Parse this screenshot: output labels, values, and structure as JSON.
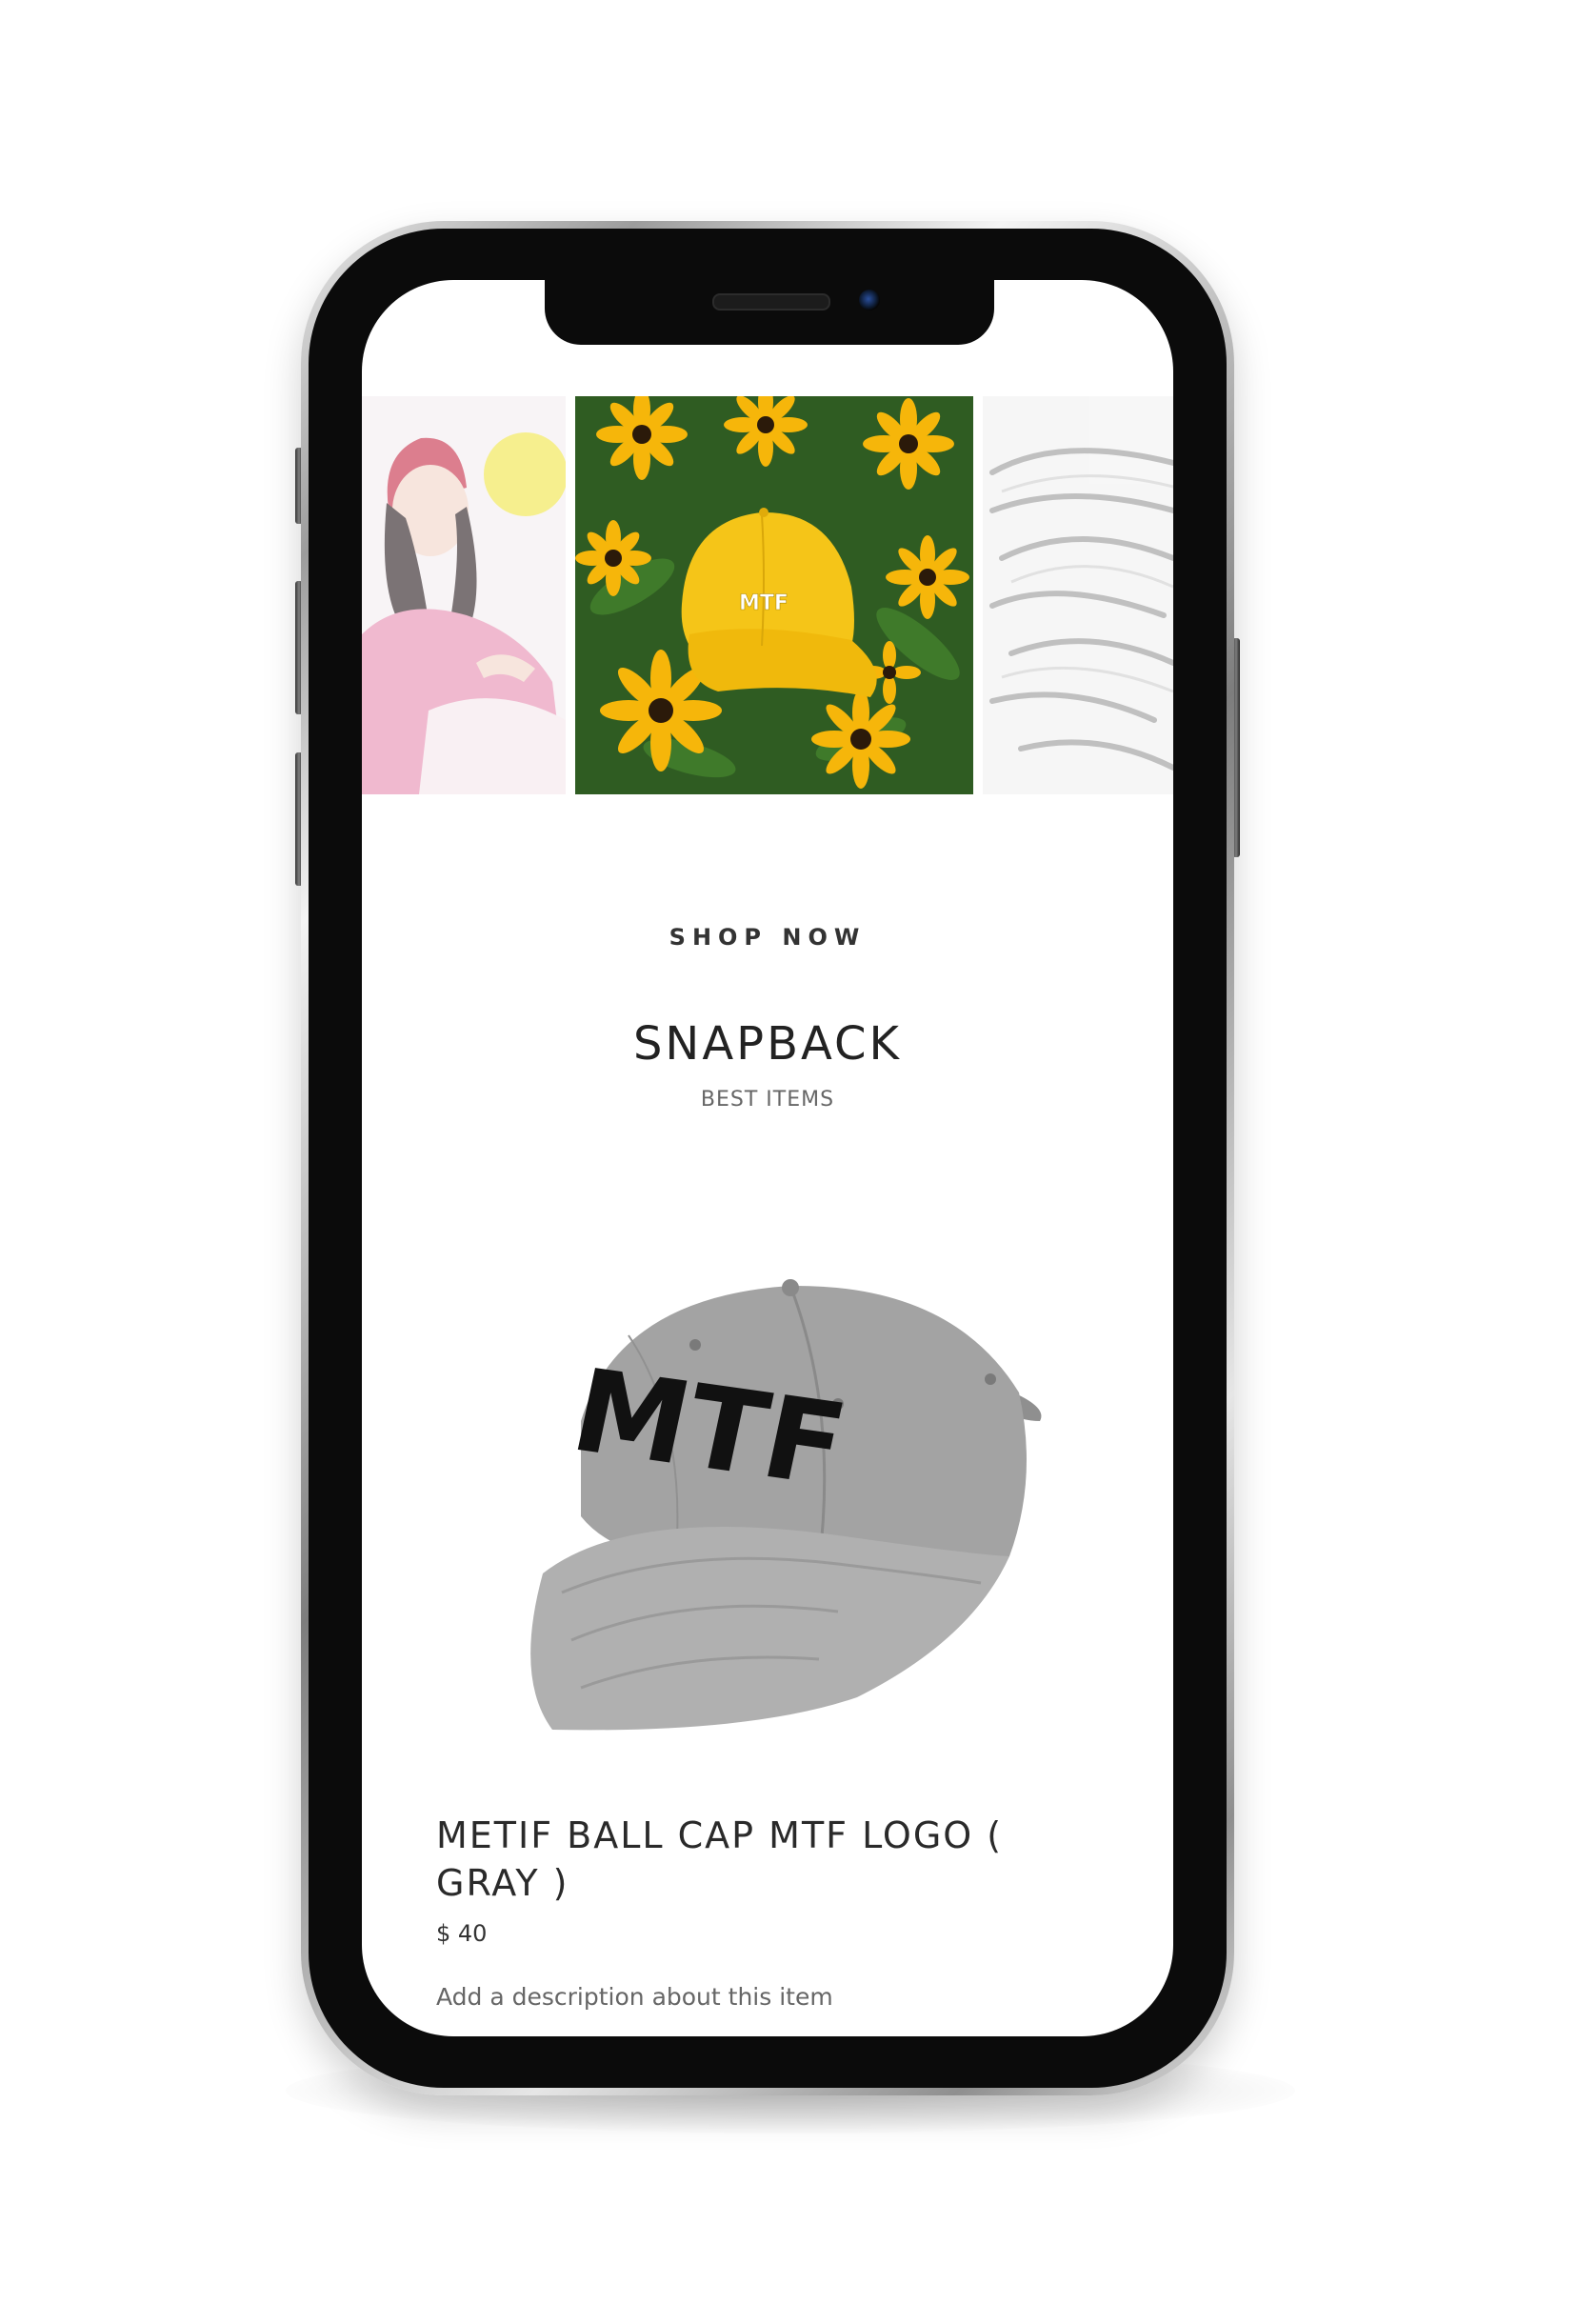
{
  "hero": {
    "center_logo_text": "MTF"
  },
  "section": {
    "shop_now_label": "SHOP NOW",
    "title": "SNAPBACK",
    "subtitle": "BEST ITEMS"
  },
  "product": {
    "image_logo_text": "MTF",
    "title": "METIF BALL CAP MTF LOGO ( GRAY )",
    "price": "$ 40",
    "description": "Add a description about this item"
  },
  "colors": {
    "cap_yellow": "#f5c518",
    "flower_yellow": "#f6b60a",
    "leaf_green": "#2f5c22",
    "cap_gray": "#9e9e9e",
    "beanie_red": "#c8304a"
  }
}
